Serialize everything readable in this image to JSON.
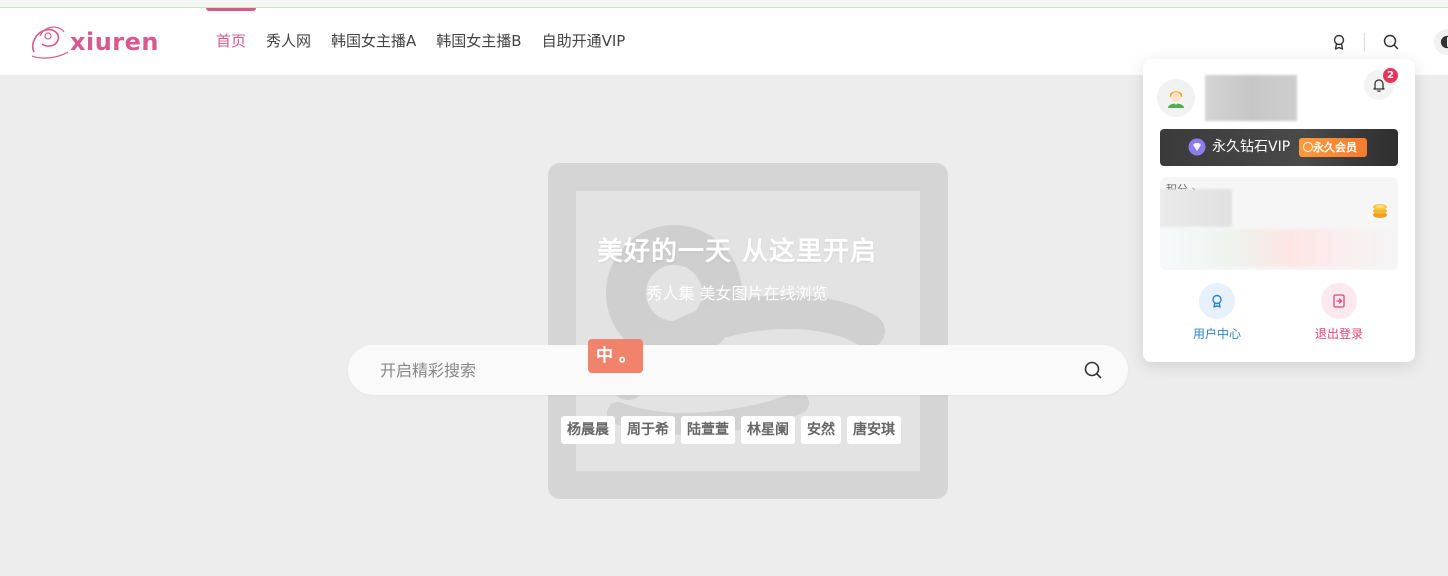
{
  "logo": {
    "text": "xiuren"
  },
  "nav": [
    {
      "label": "首页",
      "active": true
    },
    {
      "label": "秀人网",
      "active": false
    },
    {
      "label": "韩国女主播A",
      "active": false
    },
    {
      "label": "韩国女主播B",
      "active": false
    },
    {
      "label": "自助开通VIP",
      "active": false
    }
  ],
  "header_icons": [
    "award-icon",
    "search-icon",
    "theme-toggle-icon"
  ],
  "hero": {
    "title": "美好的一天 从这里开启",
    "subtitle": "秀人集 美女图片在线浏览",
    "search": {
      "placeholder": "开启精彩搜索",
      "value": ""
    },
    "ime_indicator": "中 。",
    "tags": [
      "杨晨晨",
      "周于希",
      "陆萱萱",
      "林星阑",
      "安然",
      "唐安琪"
    ]
  },
  "user_panel": {
    "notification_count": "2",
    "vip_label": "永久钻石VIP",
    "vip_badge": "永久会员",
    "points_label": "积分 ›",
    "actions": [
      {
        "label": "用户中心",
        "icon": "award-icon",
        "color": "#2e84d0"
      },
      {
        "label": "退出登录",
        "icon": "logout-icon",
        "color": "#e0457b"
      }
    ]
  },
  "colors": {
    "accent": "#d9588d",
    "background": "#ededed",
    "vip_badge": "#f57b2e",
    "notification_badge": "#e8345a"
  }
}
